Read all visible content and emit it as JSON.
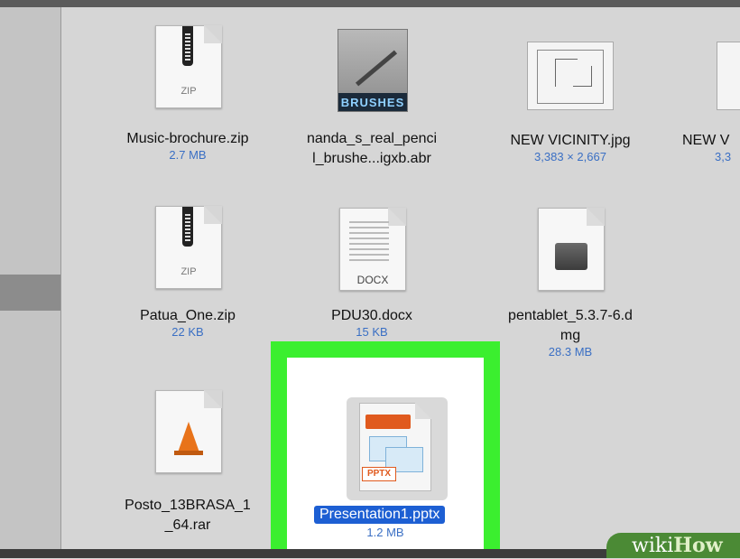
{
  "files": [
    {
      "name": "Music-brochure.zip",
      "meta": "2.7 MB",
      "icon": "zip-archive-icon",
      "ext": "ZIP"
    },
    {
      "name": "nanda_s_real_penci",
      "name2": "l_brushe...igxb.abr",
      "icon": "brushes-icon",
      "ext": "BRUSHES"
    },
    {
      "name": "NEW VICINITY.jpg",
      "meta": "3,383 × 2,667",
      "icon": "image-thumbnail-icon"
    },
    {
      "name": "NEW V",
      "meta": "3,3",
      "icon": "image-thumbnail-icon"
    },
    {
      "name": "Patua_One.zip",
      "meta": "22 KB",
      "icon": "zip-archive-icon",
      "ext": "ZIP"
    },
    {
      "name": "PDU30.docx",
      "meta": "15 KB",
      "icon": "docx-document-icon",
      "ext": "DOCX"
    },
    {
      "name": "pentablet_5.3.7-6.d",
      "name2": "mg",
      "meta": "28.3 MB",
      "icon": "disk-image-icon"
    },
    {
      "name": "Posto_13BRASA_1",
      "name2": "_64.rar",
      "icon": "vlc-cone-icon"
    }
  ],
  "selected": {
    "name": "Presentation1.pptx",
    "meta": "1.2 MB",
    "icon": "pptx-presentation-icon",
    "ext": "PPTX",
    "highlight_color": "#3bef2f"
  },
  "watermark": {
    "part1": "wiki",
    "part2": "How"
  }
}
